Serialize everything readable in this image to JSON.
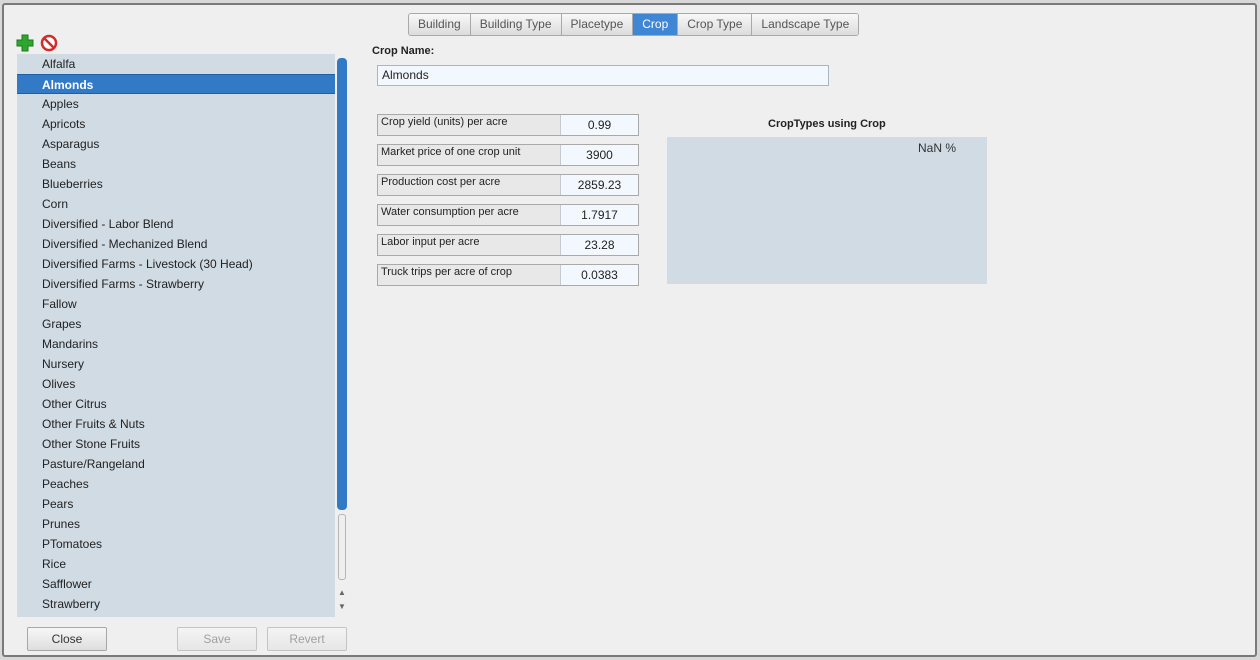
{
  "tabs": [
    {
      "label": "Building",
      "active": false
    },
    {
      "label": "Building Type",
      "active": false
    },
    {
      "label": "Placetype",
      "active": false
    },
    {
      "label": "Crop",
      "active": true
    },
    {
      "label": "Crop Type",
      "active": false
    },
    {
      "label": "Landscape Type",
      "active": false
    }
  ],
  "toolbar": {
    "add_icon": "plus-icon",
    "delete_icon": "no-entry-icon",
    "add_color": "#2fa62f",
    "delete_color": "#d42a2a"
  },
  "crops": [
    "Alfalfa",
    "Almonds",
    "Apples",
    "Apricots",
    "Asparagus",
    "Beans",
    "Blueberries",
    "Corn",
    "Diversified - Labor Blend",
    "Diversified - Mechanized Blend",
    "Diversified Farms - Livestock (30 Head)",
    "Diversified Farms - Strawberry",
    "Fallow",
    "Grapes",
    "Mandarins",
    "Nursery",
    "Olives",
    "Other Citrus",
    "Other Fruits & Nuts",
    "Other Stone Fruits",
    "Pasture/Rangeland",
    "Peaches",
    "Pears",
    "Prunes",
    "PTomatoes",
    "Rice",
    "Safflower",
    "Strawberry"
  ],
  "selected_crop": "Almonds",
  "form": {
    "name_label": "Crop Name:",
    "name_value": "Almonds",
    "fields": [
      {
        "label": "Crop yield (units) per acre",
        "value": "0.99"
      },
      {
        "label": "Market price of one crop unit",
        "value": "3900"
      },
      {
        "label": "Production cost per acre",
        "value": "2859.23"
      },
      {
        "label": "Water consumption per acre",
        "value": "1.7917"
      },
      {
        "label": "Labor input per acre",
        "value": "23.28"
      },
      {
        "label": "Truck trips per acre of crop",
        "value": "0.0383"
      }
    ]
  },
  "chart": {
    "title": "CropTypes using Crop",
    "value_text": "NaN %"
  },
  "buttons": {
    "close": "Close",
    "save": "Save",
    "revert": "Revert"
  },
  "colors": {
    "accent": "#3279c6",
    "panel": "#d1dbe3"
  }
}
